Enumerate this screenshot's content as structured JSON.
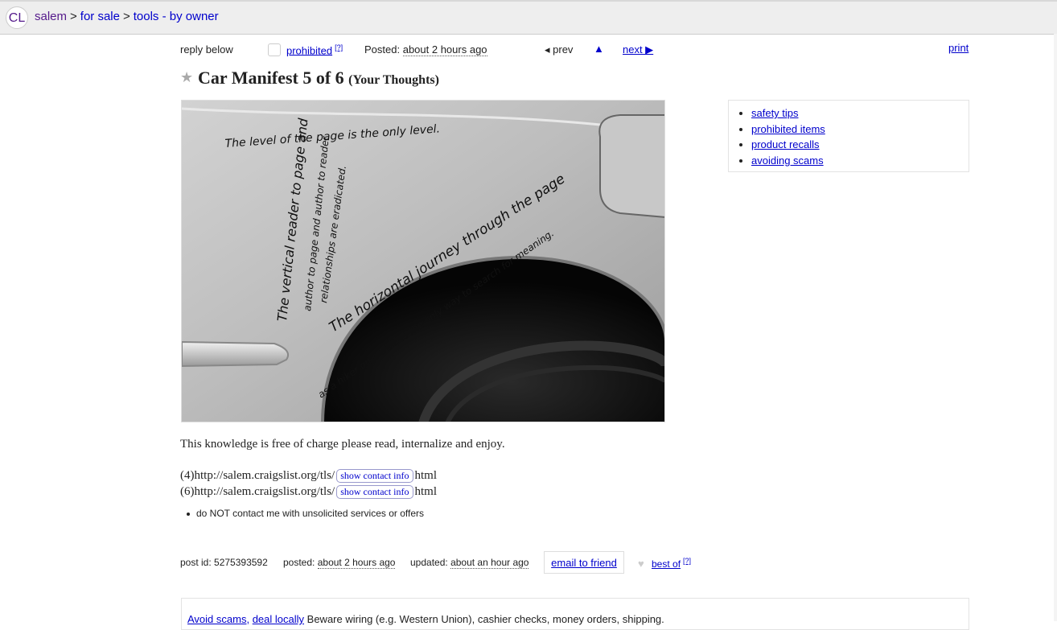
{
  "header": {
    "logo": "CL",
    "crumbs": [
      "salem",
      "for sale",
      "tools - by owner"
    ],
    "separator": ">"
  },
  "postbar": {
    "reply": "reply below",
    "prohibited": "prohibited",
    "help_marker": "[?]",
    "posted_label": "Posted:",
    "posted_time": "about 2 hours ago",
    "prev": "◂ prev",
    "up": "▲",
    "next": "next ▶",
    "print": "print"
  },
  "post": {
    "title": "Car Manifest 5 of 6",
    "title_sub": "(Your Thoughts)",
    "body": "This knowledge is free of charge please read, internalize and enjoy.",
    "links": [
      {
        "prefix": "(4)http://salem.craigslist.org/tls/",
        "button": "show contact info",
        "suffix": "html"
      },
      {
        "prefix": "(6)http://salem.craigslist.org/tls/",
        "button": "show contact info",
        "suffix": "html"
      }
    ],
    "notice": "do NOT contact me with unsolicited services or offers"
  },
  "photo": {
    "line1": "The level of the page is the only level.",
    "line2a": "The vertical reader to page and",
    "line2b": "author to page and author to reader",
    "line2c": "relationships are eradicated.",
    "line3a": "The horizontal journey through the page",
    "line3b": "as a hiker on a trail, is the only way to search for meaning."
  },
  "safety": {
    "items": [
      "safety tips",
      "prohibited items",
      "product recalls",
      "avoiding scams"
    ]
  },
  "footer": {
    "post_id_label": "post id: 5275393592",
    "posted_label": "posted:",
    "posted_time": "about 2 hours ago",
    "updated_label": "updated:",
    "updated_time": "about an hour ago",
    "email": "email to friend",
    "heart": "♥",
    "best_of": "best of",
    "help_marker": "[?]"
  },
  "scams": {
    "link1": "Avoid scams,",
    "link2": "deal locally",
    "text": "Beware wiring (e.g. Western Union), cashier checks, money orders, shipping."
  }
}
